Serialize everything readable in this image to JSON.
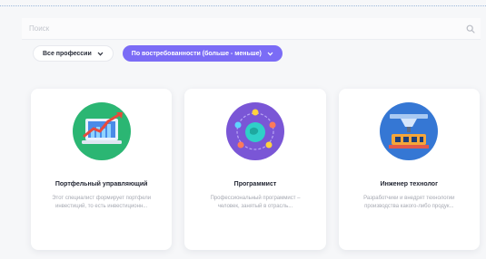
{
  "search": {
    "placeholder": "Поиск"
  },
  "filters": {
    "profession_label": "Все профессии",
    "active_filter_label": "По востребованности (больше - меньше)"
  },
  "cards": [
    {
      "title": "Портфельный управляющий",
      "description": "Этот специалист формирует портфели инвестиций, то есть инвестиционн...",
      "icon": "chart-laptop-icon"
    },
    {
      "title": "Программист",
      "description": "Профессиональный программист – человек, занятый в отрасль...",
      "icon": "globe-network-icon"
    },
    {
      "title": "Инженер технолог",
      "description": "Разработчики и внедрят технологии производства какого-либо продук...",
      "icon": "factory-machine-icon"
    }
  ],
  "colors": {
    "accent": "#7b6cf6",
    "emblem_green": "#2bb673",
    "emblem_purple": "#7a56d6",
    "emblem_blue": "#3577d4"
  }
}
